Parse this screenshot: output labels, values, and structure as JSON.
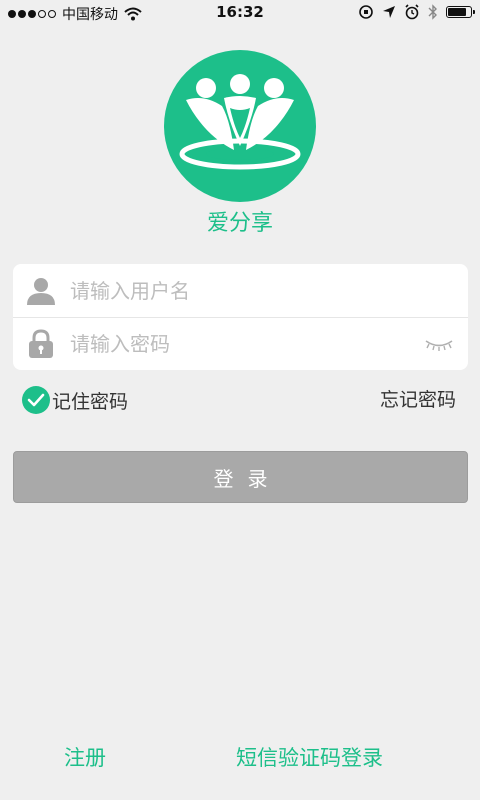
{
  "status_bar": {
    "signal_full": 3,
    "signal_total": 5,
    "carrier": "中国移动",
    "time": "16:32",
    "battery_level": 0.9
  },
  "app": {
    "name": "爱分享",
    "brand_color": "#1dbf8a"
  },
  "form": {
    "username_placeholder": "请输入用户名",
    "password_placeholder": "请输入密码",
    "username_icon": "user-icon",
    "password_icon": "lock-icon",
    "password_visibility_icon": "eye-closed-icon"
  },
  "options": {
    "remember_label": "记住密码",
    "remember_checked": true,
    "forgot_label": "忘记密码"
  },
  "login_button": {
    "label": "登录",
    "color": "#a9a9a9"
  },
  "footer": {
    "register_label": "注册",
    "sms_login_label": "短信验证码登录"
  }
}
